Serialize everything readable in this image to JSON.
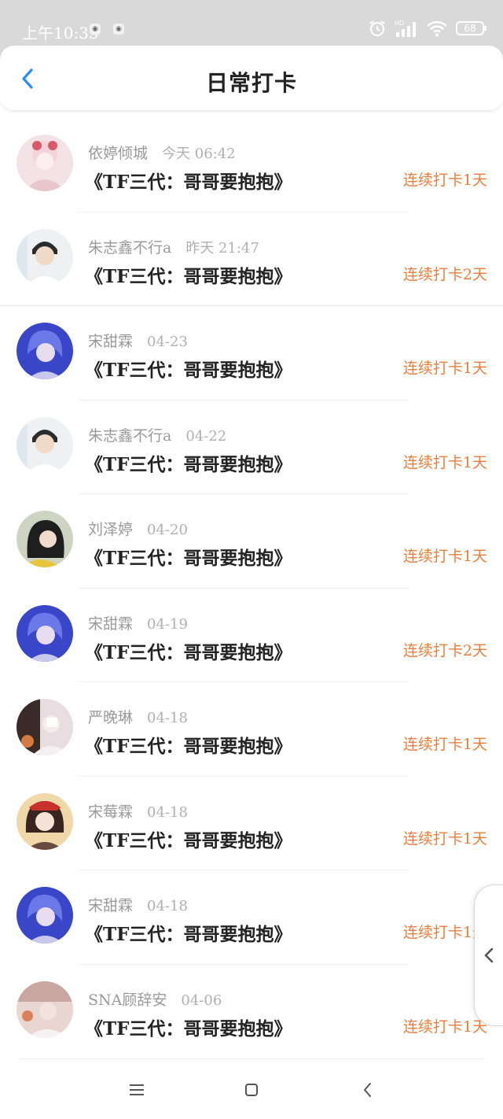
{
  "status_bar": {
    "time": "上午10:35",
    "battery": "68",
    "icons": [
      "alarm-icon",
      "hd-signal-icon",
      "wifi-icon",
      "battery-icon"
    ]
  },
  "header": {
    "title": "日常打卡",
    "back_icon": "chevron-left-icon"
  },
  "colors": {
    "accent": "#2a8ef0",
    "streak": "#ee7d3a"
  },
  "records": [
    {
      "name": "依婷倾城",
      "time": "今天 06:42",
      "book": "《TF三代：哥哥要抱抱》",
      "streak": "连续打卡1天"
    },
    {
      "name": "朱志鑫不行a",
      "time": "昨天 21:47",
      "book": "《TF三代：哥哥要抱抱》",
      "streak": "连续打卡2天"
    },
    {
      "name": "宋甜霖",
      "time": "04-23",
      "book": "《TF三代：哥哥要抱抱》",
      "streak": "连续打卡1天"
    },
    {
      "name": "朱志鑫不行a",
      "time": "04-22",
      "book": "《TF三代：哥哥要抱抱》",
      "streak": "连续打卡1天"
    },
    {
      "name": "刘泽婷",
      "time": "04-20",
      "book": "《TF三代：哥哥要抱抱》",
      "streak": "连续打卡1天"
    },
    {
      "name": "宋甜霖",
      "time": "04-19",
      "book": "《TF三代：哥哥要抱抱》",
      "streak": "连续打卡2天"
    },
    {
      "name": "严晚琳",
      "time": "04-18",
      "book": "《TF三代：哥哥要抱抱》",
      "streak": "连续打卡1天"
    },
    {
      "name": "宋莓霖",
      "time": "04-18",
      "book": "《TF三代：哥哥要抱抱》",
      "streak": "连续打卡1天"
    },
    {
      "name": "宋甜霖",
      "time": "04-18",
      "book": "《TF三代：哥哥要抱抱》",
      "streak": "连续打卡1天"
    },
    {
      "name": "SNA顾辞安",
      "time": "04-06",
      "book": "《TF三代：哥哥要抱抱》",
      "streak": "连续打卡1天"
    }
  ],
  "system_nav": [
    "menu-icon",
    "home-icon",
    "back-icon"
  ]
}
